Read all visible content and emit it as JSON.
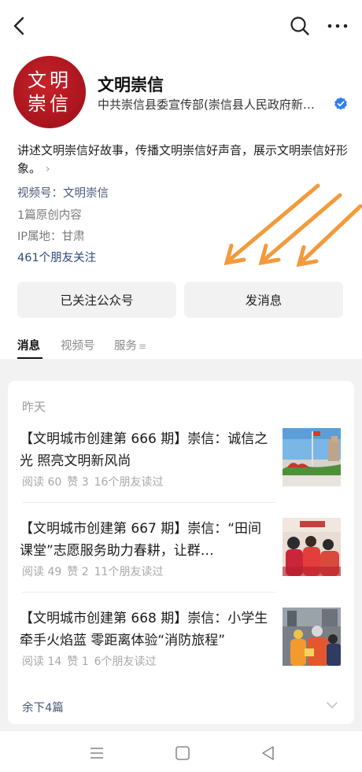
{
  "header": {
    "back_icon": "chevron-left-icon",
    "search_icon": "search-icon",
    "more_icon": "more-dots-icon"
  },
  "account": {
    "avatar_text": "文明崇信",
    "name": "文明崇信",
    "org": "中共崇信县委宣传部(崇信县人民政府新…",
    "verified_color": "#2f7df6",
    "intro": "讲述文明崇信好故事，传播文明崇信好声音，展示文明崇信好形象。",
    "channel": "视频号：文明崇信",
    "original": "1篇原创内容",
    "ip": "IP属地：甘肃",
    "friends_following": "461个朋友关注"
  },
  "actions": {
    "followed_label": "已关注公众号",
    "message_label": "发消息"
  },
  "tabs": [
    {
      "label": "消息",
      "active": true
    },
    {
      "label": "视频号",
      "active": false
    },
    {
      "label": "服务",
      "active": false
    }
  ],
  "feed": {
    "date_label": "昨天",
    "articles": [
      {
        "title": "【文明城市创建第 666 期】崇信：诚信之光 照亮文明新风尚",
        "reads": "阅读 60",
        "likes": "赞 3",
        "friends": "16个朋友读过"
      },
      {
        "title": "【文明城市创建第 667 期】崇信：“田间课堂”志愿服务助力春耕，让群…",
        "reads": "阅读 49",
        "likes": "赞 2",
        "friends": "11个朋友读过"
      },
      {
        "title": "【文明城市创建第 668 期】崇信：小学生牵手火焰蓝 零距离体验“消防旅程”",
        "reads": "阅读 14",
        "likes": "赞 1",
        "friends": "6个朋友读过"
      }
    ],
    "remaining": "余下4篇"
  },
  "annotation": {
    "arrow_color": "#f39a3c"
  },
  "nav": {
    "menu_icon": "menu-icon",
    "home_icon": "square-home-icon",
    "back_icon": "triangle-back-icon"
  }
}
